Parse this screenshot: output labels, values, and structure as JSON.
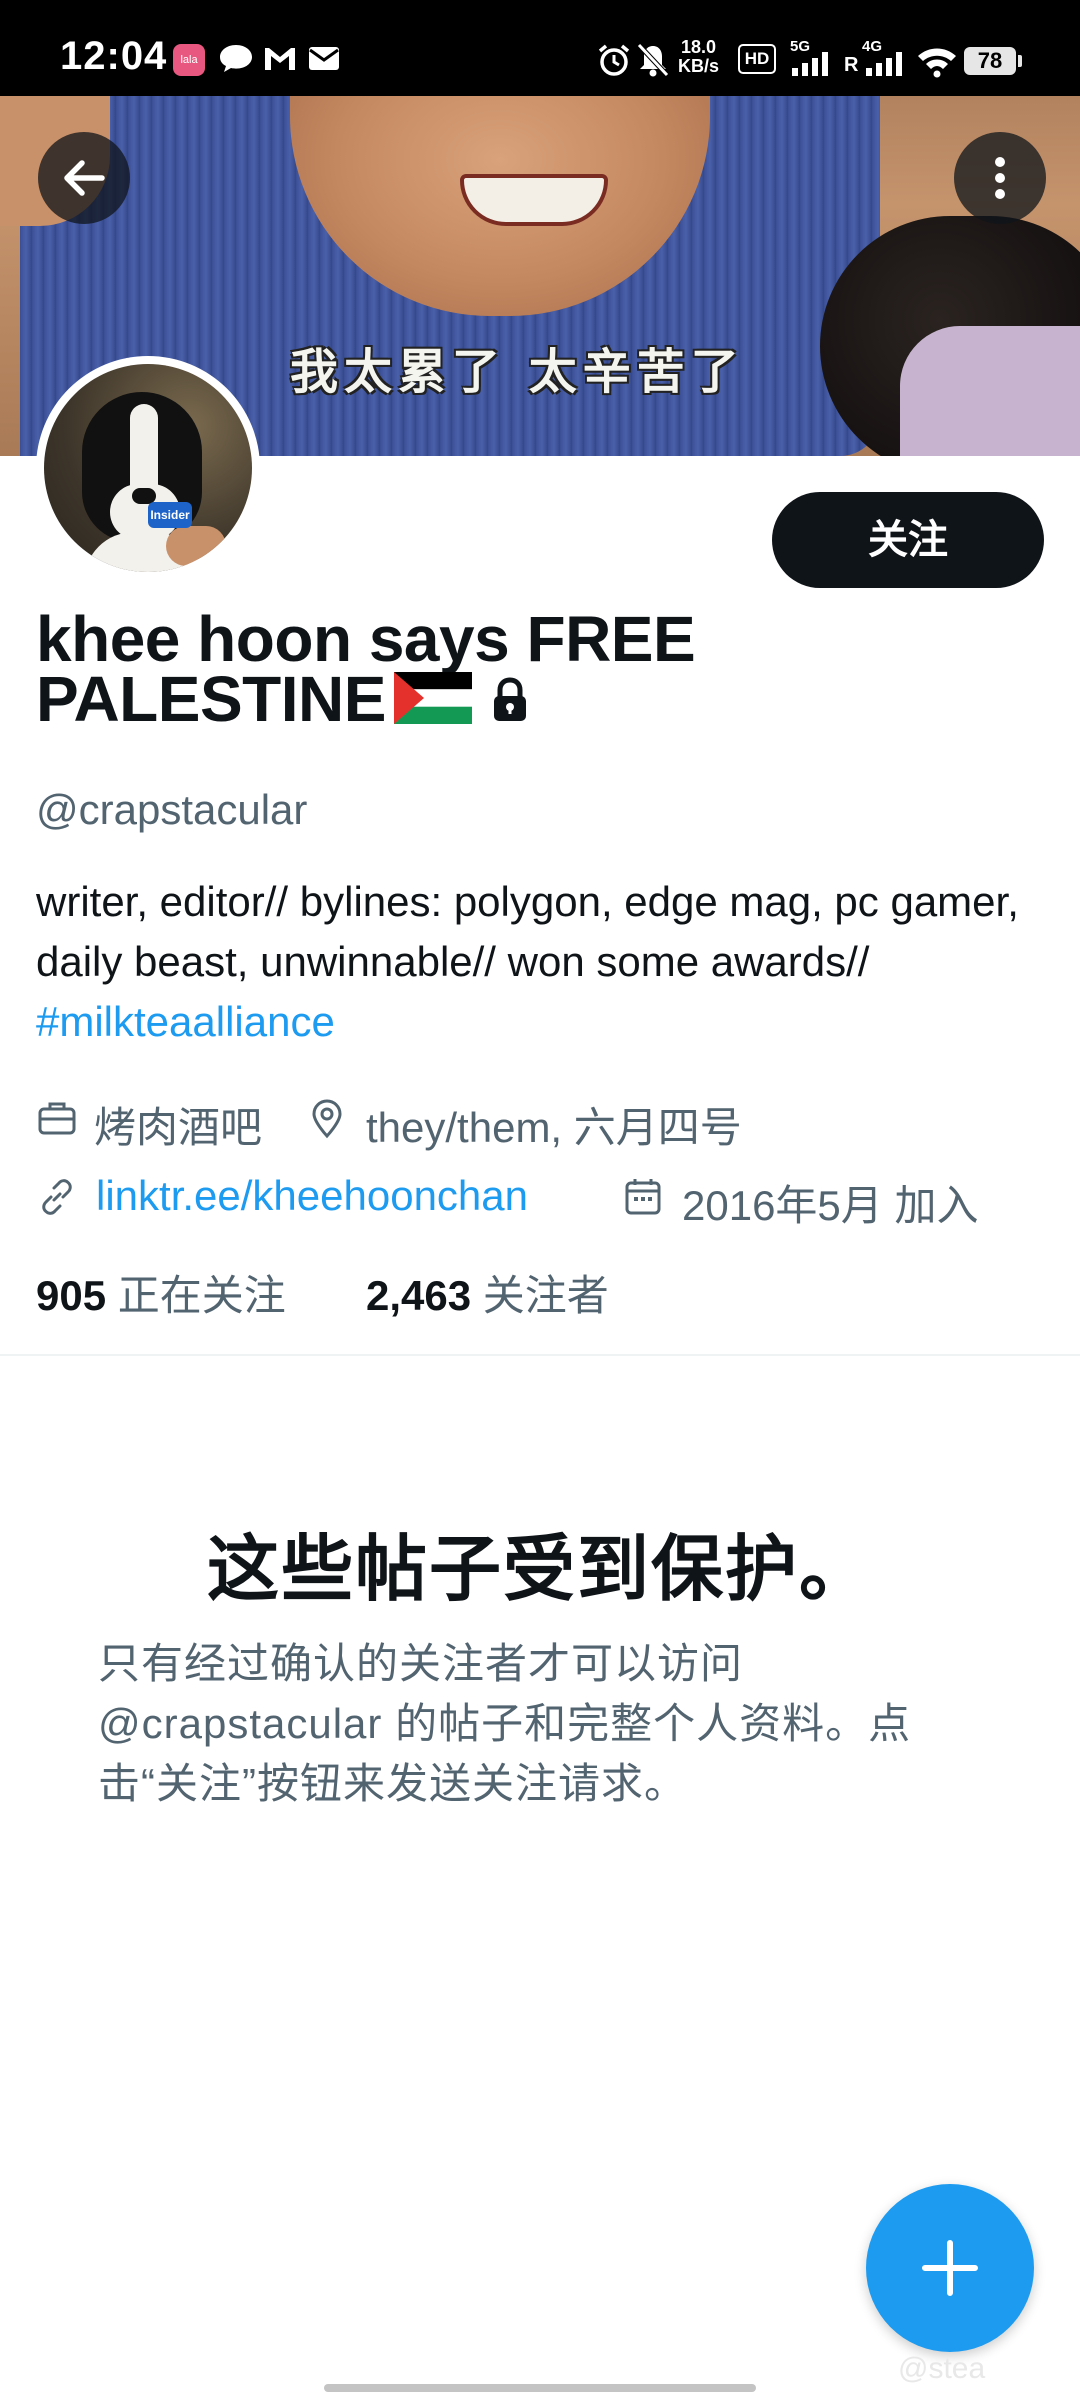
{
  "status_bar": {
    "time": "12:04",
    "notif_app_label": "lala",
    "net_speed_value": "18.0",
    "net_speed_unit": "KB/s",
    "hd_label": "HD",
    "sim1_network": "5G",
    "sim2_network": "4G",
    "sim2_roaming": "R",
    "battery": "78"
  },
  "banner": {
    "caption": "我太累了 太辛苦了"
  },
  "profile": {
    "display_name_line1": "khee hoon says FREE",
    "display_name_line2": "PALESTINE",
    "handle": "@crapstacular",
    "bio_text": "writer, editor// bylines: polygon, edge mag, pc gamer, daily beast, unwinnable// won some awards// ",
    "bio_hashtag": "#milkteaalliance",
    "category": "烤肉酒吧",
    "location": "they/them, 六月四号",
    "website": "linktr.ee/kheehoonchan",
    "joined": "2016年5月 加入",
    "following_count": "905",
    "following_label": "正在关注",
    "followers_count": "2,463",
    "followers_label": "关注者",
    "mic_logo": "Insider"
  },
  "actions": {
    "follow_label": "关注"
  },
  "protected": {
    "title": "这些帖子受到保护。",
    "description": "只有经过确认的关注者才可以访问 @crapstacular 的帖子和完整个人资料。点击“关注”按钮来发送关注请求。"
  },
  "watermark": "@stea",
  "colors": {
    "accent": "#1d9bf0",
    "text_primary": "#0f1419",
    "text_secondary": "#536471",
    "follow_button_bg": "#0f1419"
  }
}
